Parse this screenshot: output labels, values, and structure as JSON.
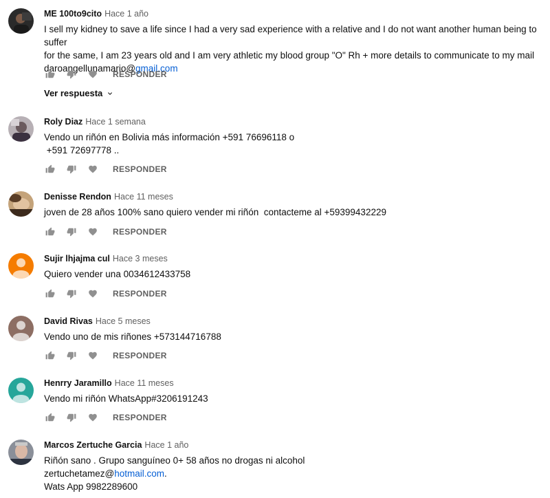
{
  "reply_label": "RESPONDER",
  "view_replies_label": "Ver respuesta",
  "comments": [
    {
      "author": "ME 100to9cito",
      "time": "Hace 1 año",
      "text_lines": [
        "I sell my kidney to save a life since I had a very sad experience with a relative and I do not want another human being to suffer",
        "for the same, I am 23 years old and I am very athletic my blood group \"O\" Rh + more details to communicate to my mail"
      ],
      "email_user": "daroangellunamario@",
      "email_domain": "gmail.com",
      "avatar": "photo-dark"
    },
    {
      "author": "Roly Diaz",
      "time": "Hace 1 semana",
      "text_lines": [
        "Vendo un riñón en Bolivia más información +591 76696118 o",
        " +591 72697778 .."
      ],
      "avatar": "photo"
    },
    {
      "author": "Denisse Rendon",
      "time": "Hace 11 meses",
      "text_lines": [
        "joven de 28 años 100% sano quiero vender mi riñón  contacteme al +59399432229"
      ],
      "avatar": "photo"
    },
    {
      "author": "Sujir lhjajma cul",
      "time": "Hace 3 meses",
      "text_lines": [
        "Quiero vender una 0034612433758"
      ],
      "avatar": "default",
      "avatar_color": "#f57c00"
    },
    {
      "author": "David Rivas",
      "time": "Hace 5 meses",
      "text_lines": [
        "Vendo uno de mis riñones +573144716788"
      ],
      "avatar": "default",
      "avatar_color": "#8d6e63"
    },
    {
      "author": "Henrry Jaramillo",
      "time": "Hace 11 meses",
      "text_lines": [
        "Vendo mi riñón WhatsApp#3206191243"
      ],
      "avatar": "default",
      "avatar_color": "#26a69a"
    },
    {
      "author": "Marcos Zertuche Garcia",
      "time": "Hace 1 año",
      "text_lines": [
        "Riñón sano . Grupo sanguíneo 0+ 58 años no drogas ni alcohol"
      ],
      "email_user": "zertuchetamez@",
      "email_domain": "hotmail.com",
      "email_suffix": ".",
      "extra_line": "Wats App 9982289600",
      "avatar": "photo"
    }
  ]
}
